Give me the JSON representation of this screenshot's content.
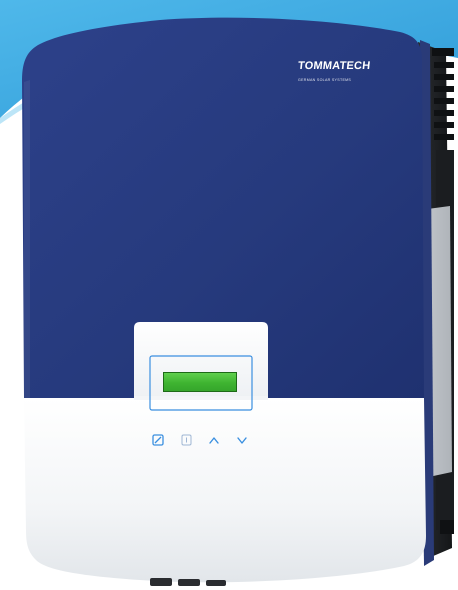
{
  "brand": {
    "name": "TOMMATECH",
    "tagline": "GERMAN SOLAR SYSTEMS"
  },
  "device": {
    "type": "solar inverter",
    "keys": [
      "power-icon",
      "escape-icon",
      "up-arrow-icon",
      "down-arrow-icon"
    ]
  },
  "colors": {
    "panel_blue": "#263b7f",
    "housing_white": "#f3f5f7",
    "lcd_green": "#46bb35",
    "backdrop_sky": "#3aa9e2",
    "key_blue": "#3a8fe0",
    "heatsink": "#1e2022"
  }
}
